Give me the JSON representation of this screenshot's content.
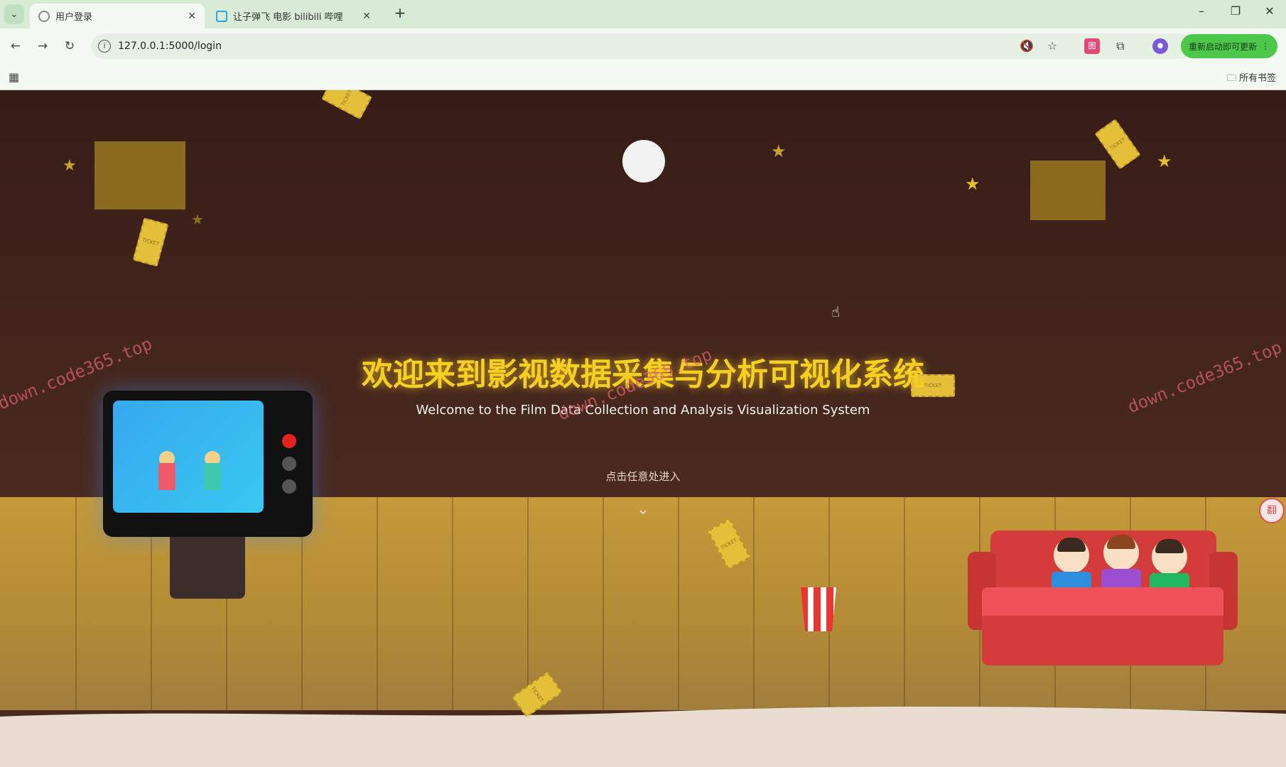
{
  "browser": {
    "tabs": [
      {
        "title": "用户登录",
        "active": true
      },
      {
        "title": "让子弹飞 电影 bilibili 哔哩",
        "active": false
      }
    ],
    "new_tab": "+",
    "tab_close": "✕",
    "url": "127.0.0.1:5000/login",
    "update_button": "重新启动即可更新",
    "bookmarks_all": "所有书签",
    "window_controls": {
      "minimize": "–",
      "restore": "❐",
      "close": "✕"
    },
    "icons": {
      "back": "←",
      "forward": "→",
      "reload": "↻",
      "info": "i",
      "mute": "🔇",
      "star": "☆",
      "ext_red": "图",
      "extensions": "⧉",
      "profile": "●",
      "menu": "⋮",
      "apps": "▦",
      "folder": "🗀",
      "tab_dropdown": "⌄"
    }
  },
  "page": {
    "title": "欢迎来到影视数据采集与分析可视化系统",
    "subtitle": "Welcome to the Film Data Collection and Analysis Visualization System",
    "enter_hint": "点击任意处进入",
    "chevron": "⌄",
    "ticket_text": "TICKET",
    "watermarks": [
      "down.code365.top",
      "down.code365.top",
      "down.code365.top"
    ],
    "side_button": "翻",
    "star_glyph": "★",
    "cursor": "☝"
  },
  "colors": {
    "title": "#f4d020",
    "background": "#371c17",
    "floor": "#c49a3a",
    "sofa": "#d43b3b"
  }
}
